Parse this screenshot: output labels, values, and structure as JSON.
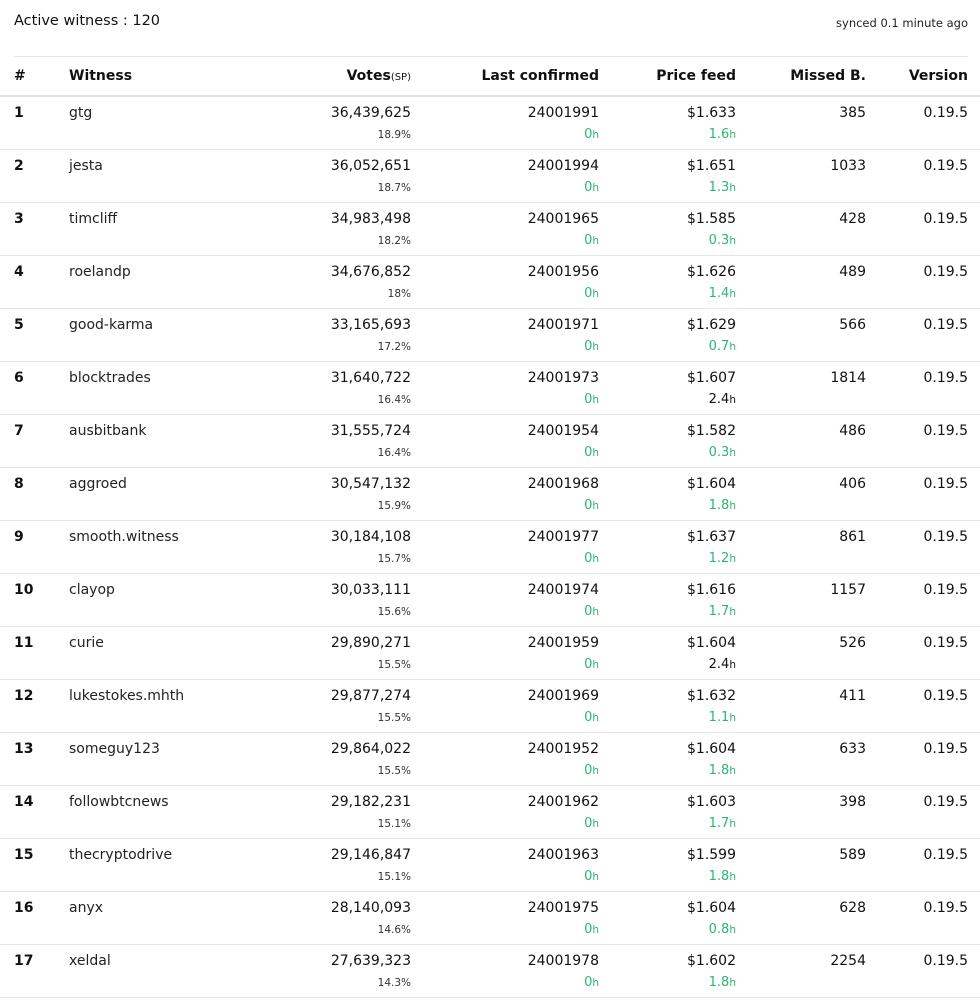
{
  "header": {
    "active_witness": "Active witness : 120",
    "synced": "synced 0.1 minute ago"
  },
  "columns": {
    "rank": "#",
    "witness": "Witness",
    "votes": "Votes",
    "votes_unit": "(SP)",
    "last_confirmed": "Last confirmed",
    "price_feed": "Price feed",
    "missed": "Missed B.",
    "version": "Version"
  },
  "hour_unit": "h",
  "status_colors": {
    "fresh": "#2bb673",
    "stale": "#111111"
  },
  "rows": [
    {
      "rank": "1",
      "witness": "gtg",
      "votes": "36,439,625",
      "votes_pct": "18.9%",
      "last_confirmed": "24001991",
      "confirmed_age": "0",
      "price": "$1.633",
      "feed_age": "1.6",
      "feed_status": "fresh",
      "missed": "385",
      "version": "0.19.5"
    },
    {
      "rank": "2",
      "witness": "jesta",
      "votes": "36,052,651",
      "votes_pct": "18.7%",
      "last_confirmed": "24001994",
      "confirmed_age": "0",
      "price": "$1.651",
      "feed_age": "1.3",
      "feed_status": "fresh",
      "missed": "1033",
      "version": "0.19.5"
    },
    {
      "rank": "3",
      "witness": "timcliff",
      "votes": "34,983,498",
      "votes_pct": "18.2%",
      "last_confirmed": "24001965",
      "confirmed_age": "0",
      "price": "$1.585",
      "feed_age": "0.3",
      "feed_status": "fresh",
      "missed": "428",
      "version": "0.19.5"
    },
    {
      "rank": "4",
      "witness": "roelandp",
      "votes": "34,676,852",
      "votes_pct": "18%",
      "last_confirmed": "24001956",
      "confirmed_age": "0",
      "price": "$1.626",
      "feed_age": "1.4",
      "feed_status": "fresh",
      "missed": "489",
      "version": "0.19.5"
    },
    {
      "rank": "5",
      "witness": "good-karma",
      "votes": "33,165,693",
      "votes_pct": "17.2%",
      "last_confirmed": "24001971",
      "confirmed_age": "0",
      "price": "$1.629",
      "feed_age": "0.7",
      "feed_status": "fresh",
      "missed": "566",
      "version": "0.19.5"
    },
    {
      "rank": "6",
      "witness": "blocktrades",
      "votes": "31,640,722",
      "votes_pct": "16.4%",
      "last_confirmed": "24001973",
      "confirmed_age": "0",
      "price": "$1.607",
      "feed_age": "2.4",
      "feed_status": "stale",
      "missed": "1814",
      "version": "0.19.5"
    },
    {
      "rank": "7",
      "witness": "ausbitbank",
      "votes": "31,555,724",
      "votes_pct": "16.4%",
      "last_confirmed": "24001954",
      "confirmed_age": "0",
      "price": "$1.582",
      "feed_age": "0.3",
      "feed_status": "fresh",
      "missed": "486",
      "version": "0.19.5"
    },
    {
      "rank": "8",
      "witness": "aggroed",
      "votes": "30,547,132",
      "votes_pct": "15.9%",
      "last_confirmed": "24001968",
      "confirmed_age": "0",
      "price": "$1.604",
      "feed_age": "1.8",
      "feed_status": "fresh",
      "missed": "406",
      "version": "0.19.5"
    },
    {
      "rank": "9",
      "witness": "smooth.witness",
      "votes": "30,184,108",
      "votes_pct": "15.7%",
      "last_confirmed": "24001977",
      "confirmed_age": "0",
      "price": "$1.637",
      "feed_age": "1.2",
      "feed_status": "fresh",
      "missed": "861",
      "version": "0.19.5"
    },
    {
      "rank": "10",
      "witness": "clayop",
      "votes": "30,033,111",
      "votes_pct": "15.6%",
      "last_confirmed": "24001974",
      "confirmed_age": "0",
      "price": "$1.616",
      "feed_age": "1.7",
      "feed_status": "fresh",
      "missed": "1157",
      "version": "0.19.5"
    },
    {
      "rank": "11",
      "witness": "curie",
      "votes": "29,890,271",
      "votes_pct": "15.5%",
      "last_confirmed": "24001959",
      "confirmed_age": "0",
      "price": "$1.604",
      "feed_age": "2.4",
      "feed_status": "stale",
      "missed": "526",
      "version": "0.19.5"
    },
    {
      "rank": "12",
      "witness": "lukestokes.mhth",
      "votes": "29,877,274",
      "votes_pct": "15.5%",
      "last_confirmed": "24001969",
      "confirmed_age": "0",
      "price": "$1.632",
      "feed_age": "1.1",
      "feed_status": "fresh",
      "missed": "411",
      "version": "0.19.5"
    },
    {
      "rank": "13",
      "witness": "someguy123",
      "votes": "29,864,022",
      "votes_pct": "15.5%",
      "last_confirmed": "24001952",
      "confirmed_age": "0",
      "price": "$1.604",
      "feed_age": "1.8",
      "feed_status": "fresh",
      "missed": "633",
      "version": "0.19.5"
    },
    {
      "rank": "14",
      "witness": "followbtcnews",
      "votes": "29,182,231",
      "votes_pct": "15.1%",
      "last_confirmed": "24001962",
      "confirmed_age": "0",
      "price": "$1.603",
      "feed_age": "1.7",
      "feed_status": "fresh",
      "missed": "398",
      "version": "0.19.5"
    },
    {
      "rank": "15",
      "witness": "thecryptodrive",
      "votes": "29,146,847",
      "votes_pct": "15.1%",
      "last_confirmed": "24001963",
      "confirmed_age": "0",
      "price": "$1.599",
      "feed_age": "1.8",
      "feed_status": "fresh",
      "missed": "589",
      "version": "0.19.5"
    },
    {
      "rank": "16",
      "witness": "anyx",
      "votes": "28,140,093",
      "votes_pct": "14.6%",
      "last_confirmed": "24001975",
      "confirmed_age": "0",
      "price": "$1.604",
      "feed_age": "0.8",
      "feed_status": "fresh",
      "missed": "628",
      "version": "0.19.5"
    },
    {
      "rank": "17",
      "witness": "xeldal",
      "votes": "27,639,323",
      "votes_pct": "14.3%",
      "last_confirmed": "24001978",
      "confirmed_age": "0",
      "price": "$1.602",
      "feed_age": "1.8",
      "feed_status": "fresh",
      "missed": "2254",
      "version": "0.19.5"
    }
  ]
}
